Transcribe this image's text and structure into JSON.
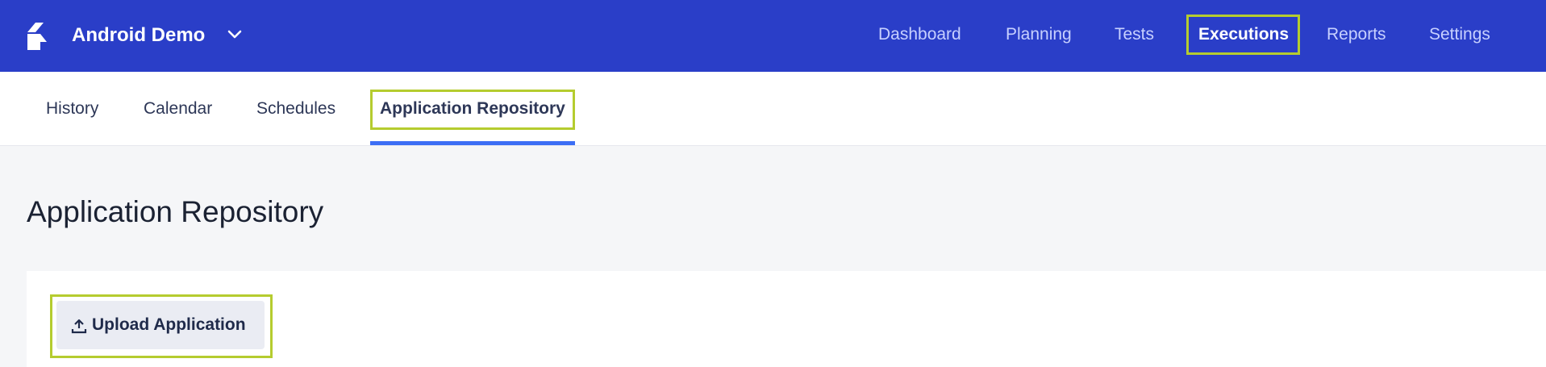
{
  "header": {
    "project_name": "Android Demo",
    "nav": [
      {
        "label": "Dashboard"
      },
      {
        "label": "Planning"
      },
      {
        "label": "Tests"
      },
      {
        "label": "Executions"
      },
      {
        "label": "Reports"
      },
      {
        "label": "Settings"
      }
    ],
    "active_nav": "Executions"
  },
  "subnav": {
    "tabs": [
      {
        "label": "History"
      },
      {
        "label": "Calendar"
      },
      {
        "label": "Schedules"
      },
      {
        "label": "Application Repository"
      }
    ],
    "active_tab": "Application Repository"
  },
  "main": {
    "title": "Application Repository",
    "upload_button_label": "Upload Application"
  },
  "colors": {
    "header_bg": "#2a3ec8",
    "highlight": "#b5cc2f",
    "tab_underline": "#3c6ef5"
  },
  "icons": {
    "logo": "app-logo",
    "chevron": "chevron-down-icon",
    "upload": "upload-icon"
  }
}
